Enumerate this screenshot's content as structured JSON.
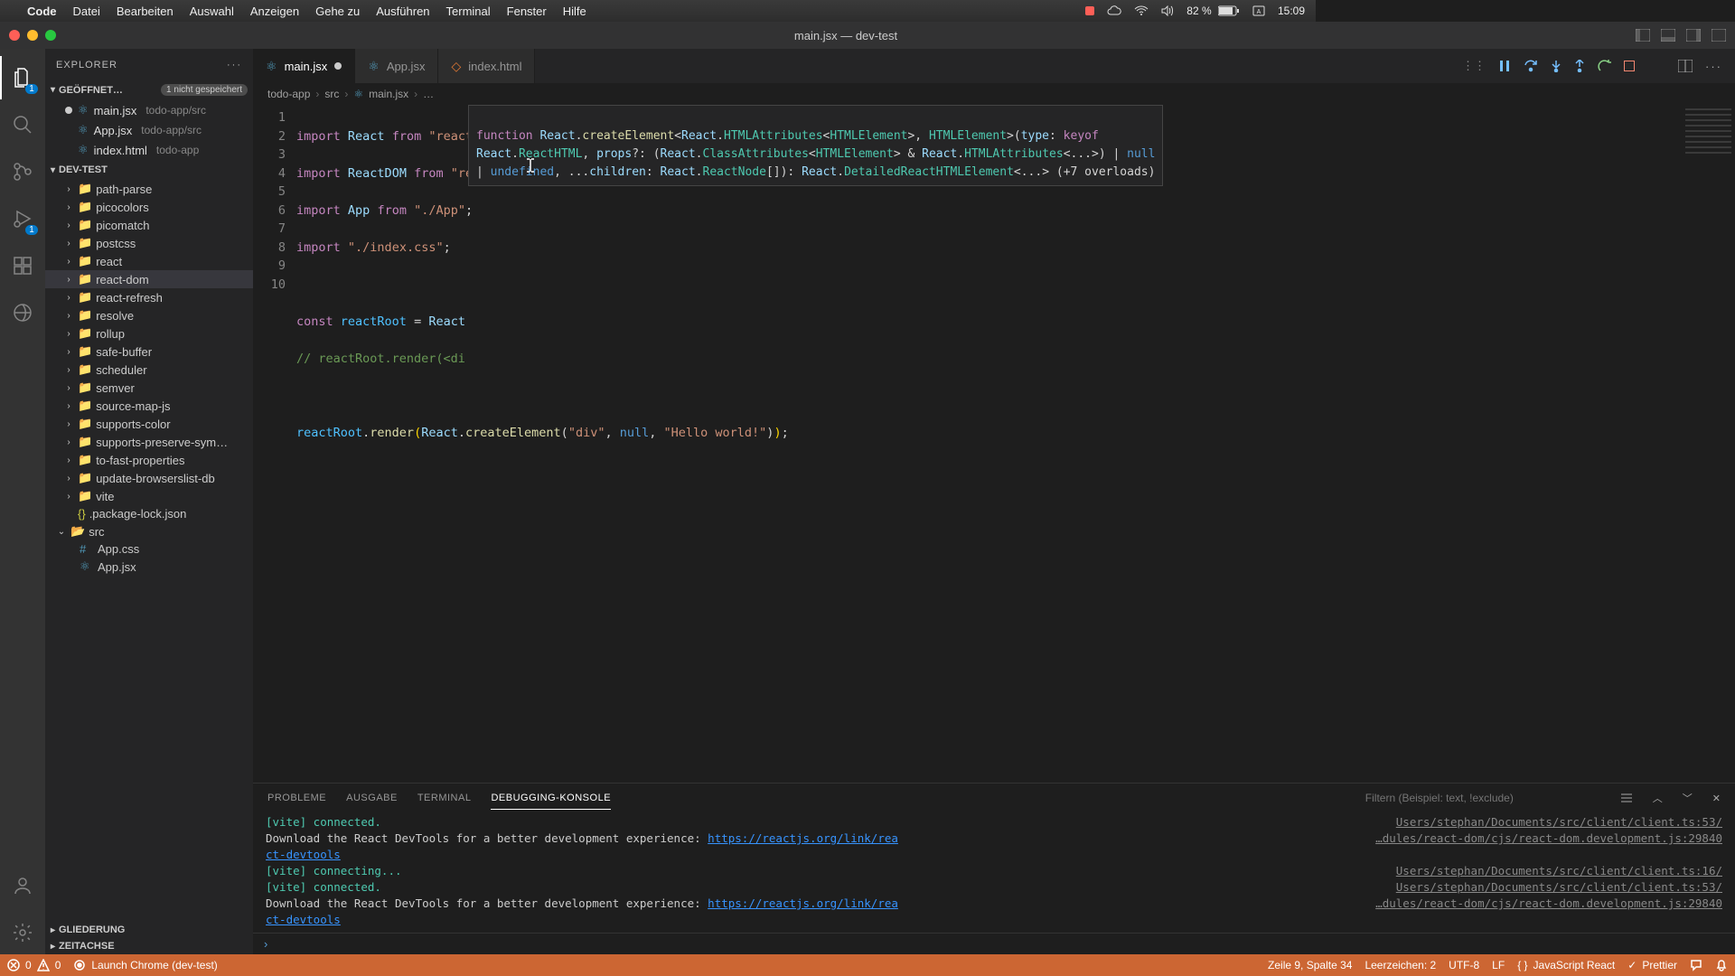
{
  "menubar": {
    "app": "Code",
    "items": [
      "Datei",
      "Bearbeiten",
      "Auswahl",
      "Anzeigen",
      "Gehe zu",
      "Ausführen",
      "Terminal",
      "Fenster",
      "Hilfe"
    ],
    "battery": "82 %",
    "time": "15:09"
  },
  "window_title": "main.jsx — dev-test",
  "sidebar": {
    "title": "EXPLORER",
    "open_editors_label": "GEÖFFNET…",
    "unsaved_pill": "1 nicht gespeichert",
    "open_editors": [
      {
        "name": "main.jsx",
        "path": "todo-app/src",
        "modified": true
      },
      {
        "name": "App.jsx",
        "path": "todo-app/src",
        "modified": false
      },
      {
        "name": "index.html",
        "path": "todo-app",
        "modified": false
      }
    ],
    "project": "DEV-TEST",
    "folders": [
      "path-parse",
      "picocolors",
      "picomatch",
      "postcss",
      "react",
      "react-dom",
      "react-refresh",
      "resolve",
      "rollup",
      "safe-buffer",
      "scheduler",
      "semver",
      "source-map-js",
      "supports-color",
      "supports-preserve-sym…",
      "to-fast-properties",
      "update-browserslist-db",
      "vite"
    ],
    "selected_folder": "react-dom",
    "files_after": [
      {
        "name": ".package-lock.json",
        "kind": "json"
      }
    ],
    "src_folder": "src",
    "src_files": [
      {
        "name": "App.css",
        "kind": "css"
      },
      {
        "name": "App.jsx",
        "kind": "jsx"
      }
    ],
    "outline": "GLIEDERUNG",
    "timeline": "ZEITACHSE"
  },
  "activity_badges": {
    "explorer": "1",
    "debug": "1"
  },
  "tabs": [
    {
      "name": "main.jsx",
      "icon": "jsx",
      "modified": true,
      "active": true
    },
    {
      "name": "App.jsx",
      "icon": "jsx",
      "modified": false,
      "active": false
    },
    {
      "name": "index.html",
      "icon": "html",
      "modified": false,
      "active": false
    }
  ],
  "breadcrumb": [
    "todo-app",
    "src",
    "main.jsx",
    "…"
  ],
  "code": {
    "lines": [
      "1",
      "2",
      "3",
      "4",
      "5",
      "6",
      "7",
      "8",
      "9",
      "10"
    ],
    "l6_prefix": "const reactRoot = React",
    "l9": "reactRoot.render(React.createElement(\"div\", null, \"Hello world!\"));",
    "tooltip_l1": "function React.createElement<React.HTMLAttributes<HTMLElement>, HTMLElement>(type: keyof",
    "tooltip_l2": "React.ReactHTML, props?: (React.ClassAttributes<HTMLElement> & React.HTMLAttributes<...>) | null",
    "tooltip_l3": "| undefined, ...children: React.ReactNode[]): React.DetailedReactHTMLElement<...> (+7 overloads)"
  },
  "panel": {
    "tabs": [
      "PROBLEME",
      "AUSGABE",
      "TERMINAL",
      "DEBUGGING-KONSOLE"
    ],
    "active_tab": 3,
    "filter_placeholder": "Filtern (Beispiel: text, !exclude)",
    "lines": [
      {
        "msg": "[vite] connected.",
        "cls": "vite",
        "src": "Users/stephan/Documents/src/client/client.ts:53/"
      },
      {
        "msg": "Download the React DevTools for a better development experience: https://reactjs.org/link/rea",
        "link": true,
        "src": "…dules/react-dom/cjs/react-dom.development.js:29840"
      },
      {
        "msg": "ct-devtools",
        "link": true
      },
      {
        "msg": "[vite] connecting...",
        "cls": "vite",
        "src": "Users/stephan/Documents/src/client/client.ts:16/"
      },
      {
        "msg": "[vite] connected.",
        "cls": "vite",
        "src": "Users/stephan/Documents/src/client/client.ts:53/"
      },
      {
        "msg": "Download the React DevTools for a better development experience: https://reactjs.org/link/rea",
        "link": true,
        "src": "…dules/react-dom/cjs/react-dom.development.js:29840"
      },
      {
        "msg": "ct-devtools",
        "link": true
      }
    ]
  },
  "status": {
    "errors": "0",
    "warnings": "0",
    "launch": "Launch Chrome (dev-test)",
    "cursor": "Zeile 9, Spalte 34",
    "spaces": "Leerzeichen: 2",
    "encoding": "UTF-8",
    "eol": "LF",
    "lang": "JavaScript React",
    "prettier": "Prettier"
  }
}
